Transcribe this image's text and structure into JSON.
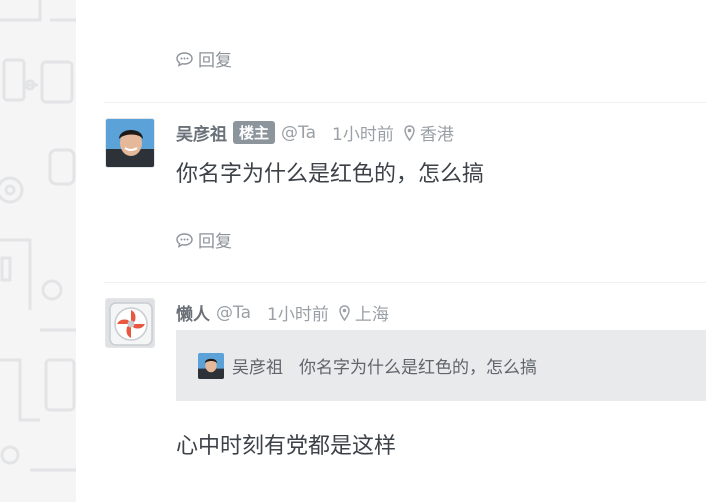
{
  "thread": {
    "reply_label": "回复",
    "comments": [
      {
        "author": "吴彦祖",
        "badge": "楼主",
        "handle": "@Ta",
        "time": "1小时前",
        "location": "香港",
        "content": "你名字为什么是红色的，怎么搞"
      },
      {
        "author": "懒人",
        "handle": "@Ta",
        "time": "1小时前",
        "location": "上海",
        "quote": {
          "author": "吴彦祖",
          "text": "你名字为什么是红色的，怎么搞"
        },
        "content": "心中时刻有党都是这样"
      }
    ]
  },
  "colors": {
    "background": "#ffffff",
    "side_strip": "#f5f5f6",
    "badge": "#8c949c",
    "quote_bg": "#e9eaec",
    "muted_text": "#9aa0a6",
    "fan_accent": "#e8573f"
  }
}
